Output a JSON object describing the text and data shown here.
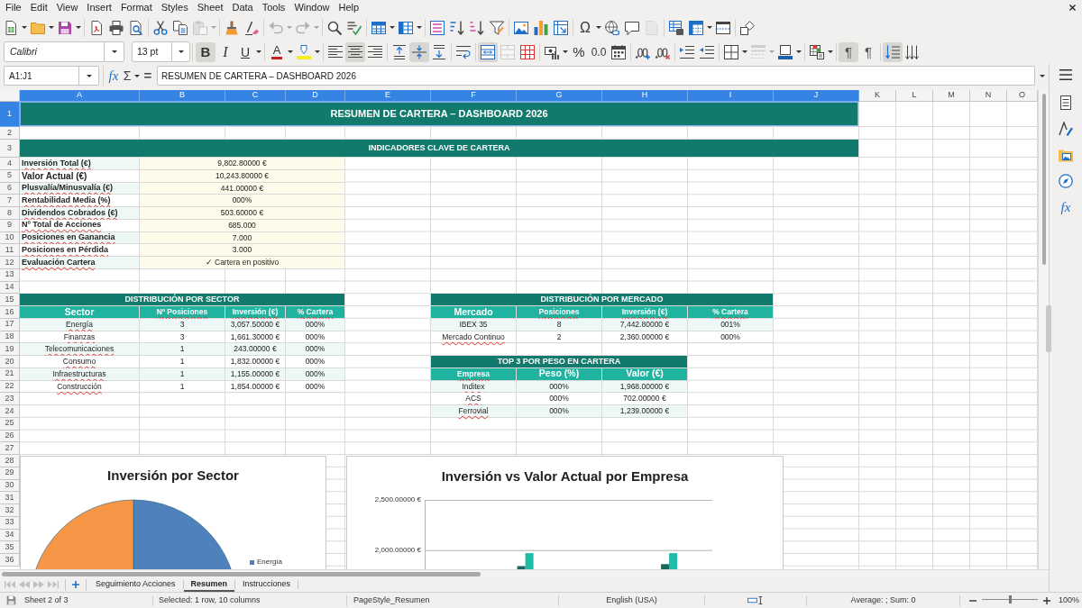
{
  "menu_bar": [
    "File",
    "Edit",
    "View",
    "Insert",
    "Format",
    "Styles",
    "Sheet",
    "Data",
    "Tools",
    "Window",
    "Help"
  ],
  "standard_toolbar": [
    {
      "disabled": false
    },
    {
      "disabled": false
    },
    {
      "disabled": false
    },
    {
      "disabled": false
    },
    {
      "disabled": false
    },
    {
      "disabled": false
    },
    {
      "disabled": false
    },
    {
      "disabled": false
    },
    {
      "disabled": true
    },
    {
      "disabled": false
    },
    {
      "disabled": false
    },
    {
      "disabled": true
    },
    {
      "disabled": true
    },
    {
      "disabled": false
    },
    {
      "disabled": false
    },
    {
      "disabled": false
    },
    {
      "disabled": false
    },
    {
      "disabled": false
    },
    {
      "disabled": false
    },
    {
      "disabled": false
    },
    {
      "disabled": false
    },
    {
      "disabled": false
    },
    {
      "disabled": false
    },
    {
      "disabled": false
    },
    {
      "glyph": "Ω",
      "disabled": false
    },
    {
      "disabled": false
    },
    {
      "disabled": false
    },
    {
      "disabled": true
    },
    {
      "disabled": false
    },
    {
      "disabled": false
    },
    {
      "disabled": false
    },
    {
      "disabled": false
    }
  ],
  "formatting_toolbar": {
    "font_name": "Calibri",
    "font_size": "13 pt",
    "buttons": [
      {
        "glyph": "B",
        "pressed": true,
        "disabled": false
      },
      {
        "glyph": "I",
        "pressed": false,
        "disabled": false
      },
      {
        "glyph": "U",
        "pressed": false,
        "disabled": false
      },
      {
        "glyph": "A",
        "pressed": false,
        "disabled": false
      },
      {
        "pressed": false,
        "disabled": false
      },
      {
        "pressed": false,
        "disabled": false
      },
      {
        "pressed": true,
        "disabled": false
      },
      {
        "pressed": false,
        "disabled": false
      },
      {
        "pressed": false,
        "disabled": false
      },
      {
        "pressed": true,
        "disabled": false
      },
      {
        "pressed": false,
        "disabled": false
      },
      {
        "pressed": false,
        "disabled": false
      },
      {
        "pressed": true,
        "disabled": false
      },
      {
        "pressed": false,
        "disabled": true
      },
      {
        "pressed": false,
        "disabled": false
      },
      {
        "pressed": false,
        "disabled": false
      },
      {
        "glyph": "%",
        "pressed": false,
        "disabled": false
      },
      {
        "glyph": "0.0",
        "pressed": false,
        "disabled": false
      },
      {
        "pressed": false,
        "disabled": false
      },
      {
        "pressed": false,
        "disabled": false
      },
      {
        "pressed": false,
        "disabled": false
      },
      {
        "pressed": false,
        "disabled": false
      },
      {
        "pressed": false,
        "disabled": false
      },
      {
        "pressed": false,
        "disabled": false
      },
      {
        "pressed": false,
        "disabled": true
      },
      {
        "pressed": false,
        "disabled": false
      },
      {
        "pressed": false,
        "disabled": false
      },
      {
        "glyph": "¶",
        "pressed": true,
        "disabled": false
      },
      {
        "glyph": "¶",
        "pressed": false,
        "disabled": false
      },
      {
        "pressed": true,
        "disabled": false
      },
      {
        "pressed": false,
        "disabled": false
      }
    ]
  },
  "formula_bar": {
    "name_box": "A1:J1",
    "function_wizard": "fx",
    "sum": "Σ",
    "equals": "=",
    "content": "RESUMEN DE CARTERA – DASHBOARD 2026"
  },
  "sidebar": {
    "functions": "fx"
  },
  "sheet": {
    "columns": [
      {
        "label": "A",
        "selected": true
      },
      {
        "label": "B",
        "selected": true
      },
      {
        "label": "C",
        "selected": true
      },
      {
        "label": "D",
        "selected": true
      },
      {
        "label": "E",
        "selected": true
      },
      {
        "label": "F",
        "selected": true
      },
      {
        "label": "G",
        "selected": true
      },
      {
        "label": "H",
        "selected": true
      },
      {
        "label": "I",
        "selected": true
      },
      {
        "label": "J",
        "selected": true
      },
      {
        "label": "K",
        "selected": false
      },
      {
        "label": "L",
        "selected": false
      },
      {
        "label": "M",
        "selected": false
      },
      {
        "label": "N",
        "selected": false
      },
      {
        "label": "O",
        "selected": false
      }
    ],
    "rows": [
      {
        "label": "1",
        "selected": true
      },
      {
        "label": "2",
        "selected": false
      },
      {
        "label": "3",
        "selected": false
      },
      {
        "label": "4",
        "selected": false
      },
      {
        "label": "5",
        "selected": false
      },
      {
        "label": "6",
        "selected": false
      },
      {
        "label": "7",
        "selected": false
      },
      {
        "label": "8",
        "selected": false
      },
      {
        "label": "9",
        "selected": false
      },
      {
        "label": "10",
        "selected": false
      },
      {
        "label": "11",
        "selected": false
      },
      {
        "label": "12",
        "selected": false
      },
      {
        "label": "13",
        "selected": false
      },
      {
        "label": "14",
        "selected": false
      },
      {
        "label": "15",
        "selected": false
      },
      {
        "label": "16",
        "selected": false
      },
      {
        "label": "17",
        "selected": false
      },
      {
        "label": "18",
        "selected": false
      },
      {
        "label": "19",
        "selected": false
      },
      {
        "label": "20",
        "selected": false
      },
      {
        "label": "21",
        "selected": false
      },
      {
        "label": "22",
        "selected": false
      },
      {
        "label": "23",
        "selected": false
      },
      {
        "label": "24",
        "selected": false
      },
      {
        "label": "25",
        "selected": false
      },
      {
        "label": "26",
        "selected": false
      },
      {
        "label": "27",
        "selected": false
      },
      {
        "label": "28",
        "selected": false
      },
      {
        "label": "29",
        "selected": false
      },
      {
        "label": "30",
        "selected": false
      },
      {
        "label": "31",
        "selected": false
      },
      {
        "label": "32",
        "selected": false
      },
      {
        "label": "33",
        "selected": false
      },
      {
        "label": "34",
        "selected": false
      },
      {
        "label": "35",
        "selected": false
      },
      {
        "label": "36",
        "selected": false
      }
    ],
    "title": {
      "text": "RESUMEN DE CARTERA – DASHBOARD 2026",
      "selected": true
    },
    "kpi_section": {
      "heading": "INDICADORES CLAVE DE CARTERA",
      "rows": [
        {
          "label": "Inversión Total (€)",
          "value": "9,802.80000 €",
          "spell_error": true
        },
        {
          "label": "Valor Actual (€)",
          "value": "10,243.80000 €",
          "spell_error": false
        },
        {
          "label": "Plusvalía/Minusvalía (€)",
          "value": "441.00000 €",
          "spell_error": true
        },
        {
          "label": "Rentabilidad Media (%)",
          "value": "000%",
          "spell_error": true
        },
        {
          "label": "Dividendos Cobrados (€)",
          "value": "503.60000 €",
          "spell_error": true
        },
        {
          "label": "Nº Total de Acciones",
          "value": "685.000",
          "spell_error": true
        },
        {
          "label": "Posiciones en Ganancia",
          "value": "7.000",
          "spell_error": true
        },
        {
          "label": "Posiciones en Pérdida",
          "value": "3.000",
          "spell_error": true
        },
        {
          "label": "Evaluación Cartera",
          "value": "✓ Cartera en positivo",
          "spell_error": true
        }
      ]
    },
    "sector_table": {
      "heading": "DISTRIBUCIÓN POR SECTOR",
      "columns": [
        {
          "text": "Sector",
          "spell_error": false
        },
        {
          "text": "Nº Posiciones",
          "spell_error": true
        },
        {
          "text": "Inversión (€)",
          "spell_error": true
        },
        {
          "text": "% Cartera",
          "spell_error": true
        }
      ],
      "rows": [
        {
          "label": "Energía",
          "spell_error": true,
          "values": [
            "3",
            "3,057.50000 €",
            "000%"
          ]
        },
        {
          "label": "Finanzas",
          "spell_error": true,
          "values": [
            "3",
            "1,661.30000 €",
            "000%"
          ]
        },
        {
          "label": "Telecomunicaciones",
          "spell_error": true,
          "values": [
            "1",
            "243.00000 €",
            "000%"
          ]
        },
        {
          "label": "Consumo",
          "spell_error": true,
          "values": [
            "1",
            "1,832.00000 €",
            "000%"
          ]
        },
        {
          "label": "Infraestructuras",
          "spell_error": true,
          "values": [
            "1",
            "1,155.00000 €",
            "000%"
          ]
        },
        {
          "label": "Construcción",
          "spell_error": true,
          "values": [
            "1",
            "1,854.00000 €",
            "000%"
          ]
        }
      ]
    },
    "market_table": {
      "heading": "DISTRIBUCIÓN POR MERCADO",
      "columns": [
        {
          "text": "Mercado",
          "spell_error": false
        },
        {
          "text": "Posiciones",
          "spell_error": true
        },
        {
          "text": "Inversión (€)",
          "spell_error": true
        },
        {
          "text": "% Cartera",
          "spell_error": true
        }
      ],
      "rows": [
        {
          "label": "IBEX 35",
          "spell_error": false,
          "values": [
            "8",
            "7,442.80000 €",
            "001%"
          ]
        },
        {
          "label": "Mercado Continuo",
          "spell_error": true,
          "values": [
            "2",
            "2,360.00000 €",
            "000%"
          ]
        }
      ]
    },
    "top3_table": {
      "heading": "TOP 3 POR PESO EN CARTERA",
      "columns": [
        {
          "text": "Empresa",
          "spell_error": true
        },
        {
          "text": "Peso (%)",
          "spell_error": false
        },
        {
          "text": "Valor (€)",
          "spell_error": false
        }
      ],
      "rows": [
        {
          "label": "Inditex",
          "spell_error": true,
          "values": [
            "000%",
            "1,968.00000 €"
          ]
        },
        {
          "label": "ACS",
          "spell_error": true,
          "values": [
            "000%",
            "702.00000 €"
          ]
        },
        {
          "label": "Ferrovial",
          "spell_error": true,
          "values": [
            "000%",
            "1,239.00000 €"
          ]
        }
      ]
    },
    "charts": [
      {
        "title": "Inversión por Sector",
        "legend": [
          {
            "label": "Energía",
            "color": "#4f81bd"
          }
        ]
      },
      {
        "chart_data": {
          "type": "bar",
          "title": "Inversión vs Valor Actual por Empresa",
          "ylim": [
            1800,
            2500
          ],
          "yticks": [
            {
              "value": 2000,
              "label": "2,000.00000 €"
            },
            {
              "value": 2500,
              "label": "2,500.00000 €"
            }
          ],
          "stacked": false,
          "series": [
            {
              "color": "#17675c",
              "values": [
                null,
                null,
                null,
                1840,
                null,
                null,
                null,
                null,
                1860,
                null
              ]
            },
            {
              "color": "#1fbba6",
              "values": [
                null,
                null,
                null,
                1970,
                null,
                null,
                null,
                null,
                1970,
                null
              ]
            }
          ]
        }
      }
    ]
  },
  "sheet_navigation": [
    {
      "disabled": true
    },
    {
      "disabled": true
    },
    {
      "disabled": true
    },
    {
      "disabled": true
    }
  ],
  "sheet_tabs": [
    {
      "label": "Seguimiento Acciones",
      "selected": false
    },
    {
      "label": "Resumen",
      "selected": true
    },
    {
      "label": "Instrucciones",
      "selected": false
    }
  ],
  "status_bar": {
    "sheet_position": "Sheet 2 of 3",
    "selection": "Selected: 1 row, 10 columns",
    "page_style": "PageStyle_Resumen",
    "language": "English (USA)",
    "summary": "Average: ; Sum: 0",
    "zoom": {
      "level": 0.5,
      "reading": "100%"
    }
  }
}
